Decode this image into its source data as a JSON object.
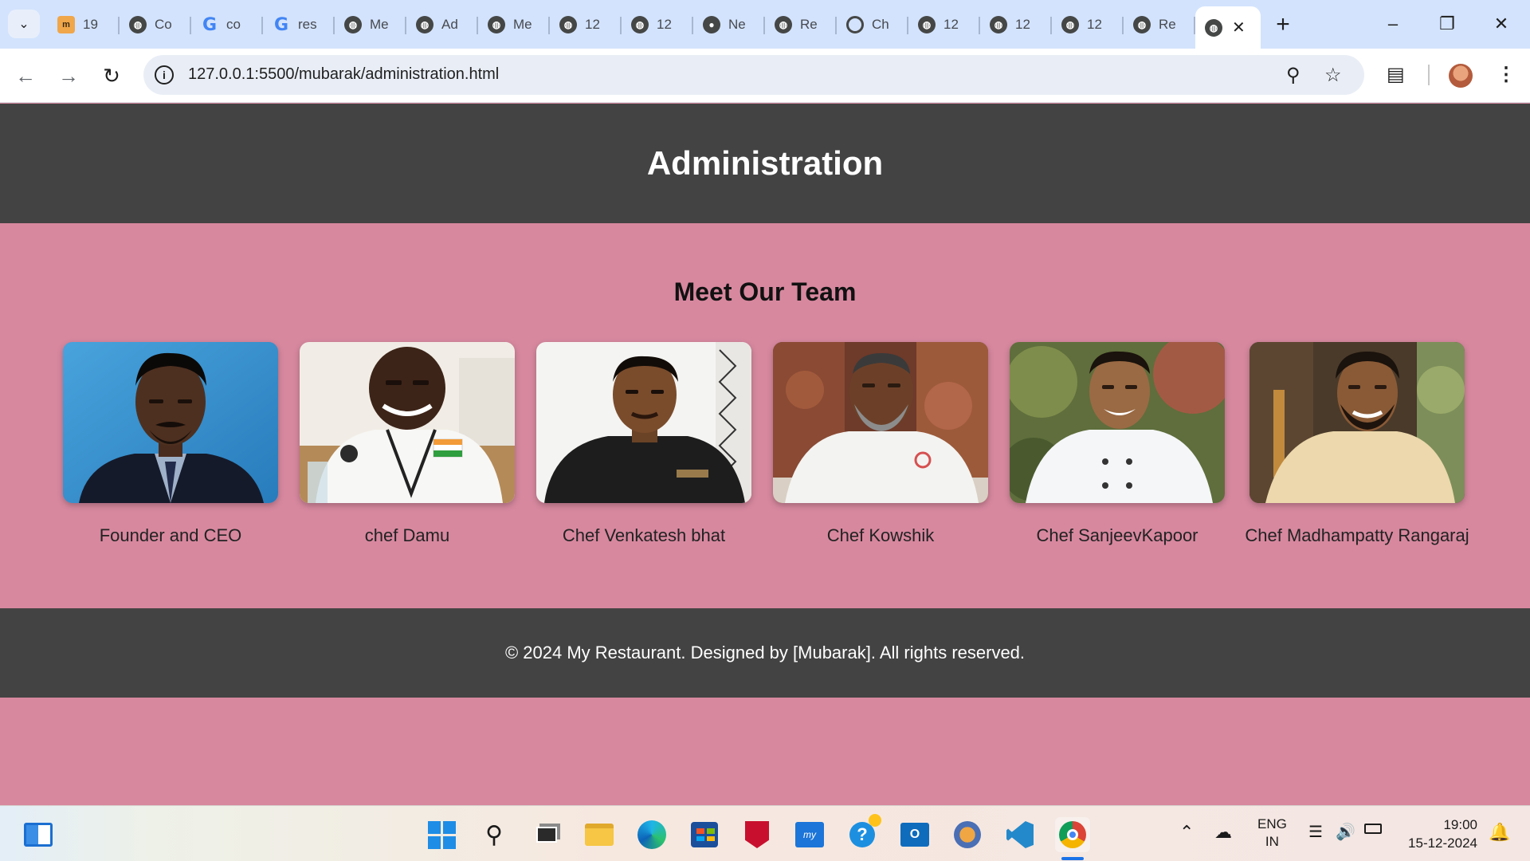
{
  "browser": {
    "tabs": [
      {
        "title": "19",
        "icon": "m-icon"
      },
      {
        "title": "Co",
        "icon": "globe-icon"
      },
      {
        "title": "co",
        "icon": "google-icon"
      },
      {
        "title": "res",
        "icon": "google-icon"
      },
      {
        "title": "Me",
        "icon": "globe-icon"
      },
      {
        "title": "Ad",
        "icon": "globe-icon"
      },
      {
        "title": "Me",
        "icon": "globe-icon"
      },
      {
        "title": "12",
        "icon": "globe-icon"
      },
      {
        "title": "12",
        "icon": "globe-icon"
      },
      {
        "title": "Ne",
        "icon": "github-icon"
      },
      {
        "title": "Re",
        "icon": "globe-icon"
      },
      {
        "title": "Ch",
        "icon": "chatgpt-icon"
      },
      {
        "title": "12",
        "icon": "globe-icon"
      },
      {
        "title": "12",
        "icon": "globe-icon"
      },
      {
        "title": "12",
        "icon": "globe-icon"
      },
      {
        "title": "Re",
        "icon": "globe-icon"
      }
    ],
    "url": "127.0.0.1:5500/mubarak/administration.html"
  },
  "page": {
    "header_title": "Administration",
    "team_title": "Meet Our Team",
    "members": [
      {
        "caption": "Founder and CEO"
      },
      {
        "caption": "chef Damu"
      },
      {
        "caption": "Chef Venkatesh bhat"
      },
      {
        "caption": "Chef Kowshik"
      },
      {
        "caption": "Chef SanjeevKapoor"
      },
      {
        "caption": "Chef Madhampatty Rangaraj"
      }
    ],
    "footer_text": "© 2024 My Restaurant. Designed by [Mubarak]. All rights reserved."
  },
  "taskbar": {
    "language": "ENG",
    "region": "IN",
    "time": "19:00",
    "date": "15-12-2024"
  },
  "colors": {
    "header_bg": "#434343",
    "page_bg": "#d7889f",
    "tabstrip_bg": "#d3e3fd"
  }
}
